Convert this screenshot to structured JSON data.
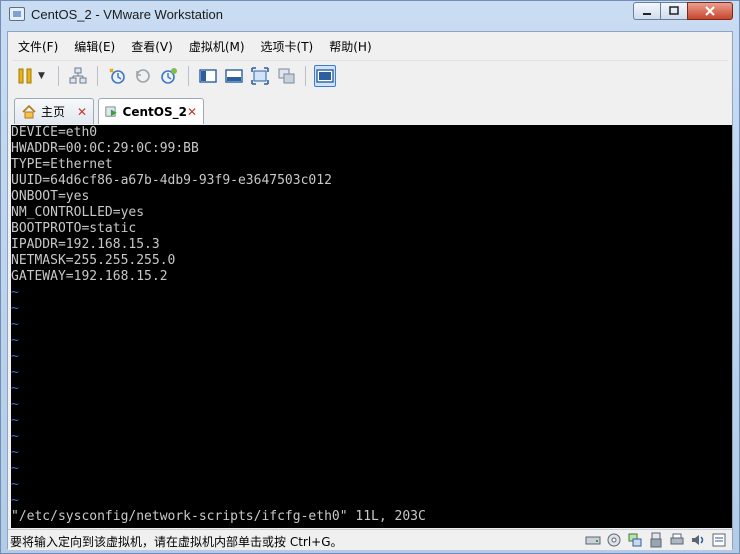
{
  "window": {
    "title": "CentOS_2 - VMware Workstation"
  },
  "menu": [
    {
      "label": "文件(F)"
    },
    {
      "label": "编辑(E)"
    },
    {
      "label": "查看(V)"
    },
    {
      "label": "虚拟机(M)"
    },
    {
      "label": "选项卡(T)"
    },
    {
      "label": "帮助(H)"
    }
  ],
  "tabs": {
    "home": {
      "label": "主页"
    },
    "vm": {
      "label": "CentOS_2"
    }
  },
  "console": {
    "lines": [
      "DEVICE=eth0",
      "HWADDR=00:0C:29:0C:99:BB",
      "TYPE=Ethernet",
      "UUID=64d6cf86-a67b-4db9-93f9-e3647503c012",
      "ONBOOT=yes",
      "NM_CONTROLLED=yes",
      "BOOTPROTO=static",
      "IPADDR=192.168.15.3",
      "NETMASK=255.255.255.0",
      "GATEWAY=192.168.15.2"
    ],
    "tilde": "~",
    "status": "\"/etc/sysconfig/network-scripts/ifcfg-eth0\" 11L, 203C"
  },
  "statusbar": {
    "text": "要将输入定向到该虚拟机，请在虚拟机内部单击或按 Ctrl+G。"
  },
  "colors": {
    "console_bg": "#000000",
    "tilde": "#3d6fd0",
    "text": "#c8c8c8"
  }
}
